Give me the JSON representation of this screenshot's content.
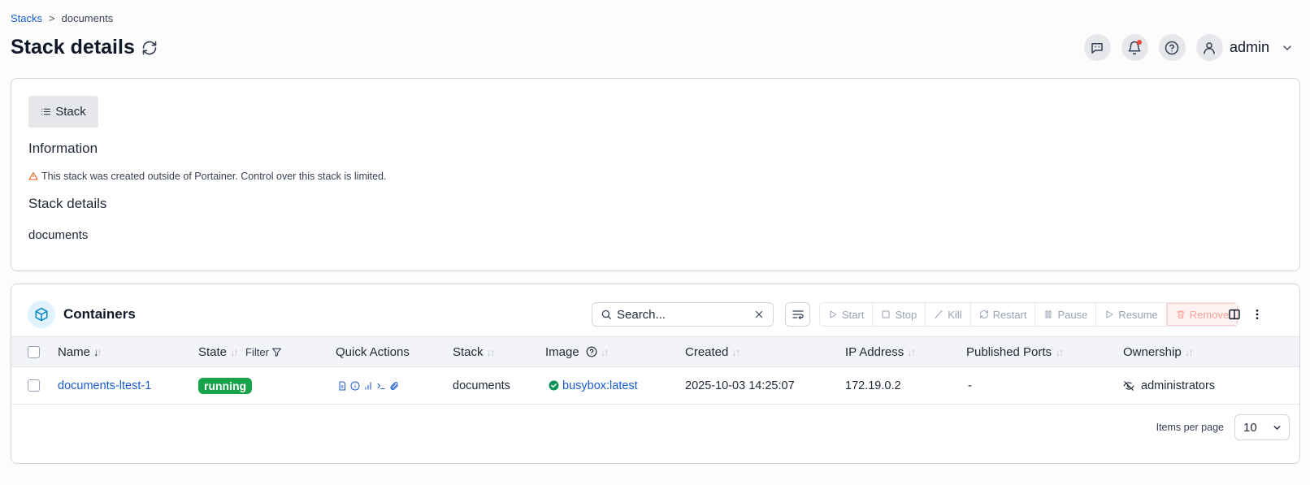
{
  "breadcrumb": {
    "root": "Stacks",
    "separator": ">",
    "current": "documents"
  },
  "header": {
    "title": "Stack details",
    "user": "admin"
  },
  "info": {
    "tab_label": "Stack",
    "information_heading": "Information",
    "warning": "This stack was created outside of Portainer. Control over this stack is limited.",
    "details_heading": "Stack details",
    "stack_name": "documents"
  },
  "containers": {
    "title": "Containers",
    "search_placeholder": "Search...",
    "actions": {
      "start": "Start",
      "stop": "Stop",
      "kill": "Kill",
      "restart": "Restart",
      "pause": "Pause",
      "resume": "Resume",
      "remove": "Remove"
    },
    "columns": {
      "name": "Name",
      "state": "State",
      "filter": "Filter",
      "quick_actions": "Quick Actions",
      "stack": "Stack",
      "image": "Image",
      "created": "Created",
      "ip": "IP Address",
      "ports": "Published Ports",
      "ownership": "Ownership"
    },
    "rows": [
      {
        "name": "documents-ltest-1",
        "state": "running",
        "stack": "documents",
        "image": "busybox:latest",
        "created": "2025-10-03 14:25:07",
        "ip": "172.19.0.2",
        "ports": "-",
        "ownership": "administrators"
      }
    ],
    "items_per_page_label": "Items per page",
    "items_per_page": "10"
  },
  "colors": {
    "accent": "#175cd3",
    "running": "#16a34a",
    "remove": "#fda29b"
  }
}
